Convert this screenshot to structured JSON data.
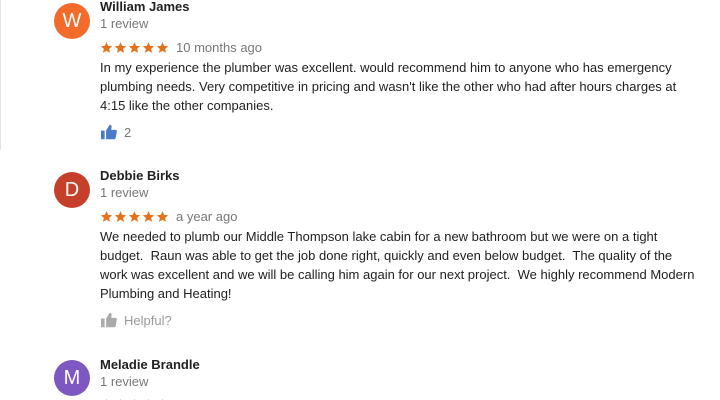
{
  "colors": {
    "avatar_w": "#f26b2a",
    "avatar_d": "#c53f2a",
    "avatar_m": "#7e57c2",
    "star": "#e7711b",
    "thumb_active": "#4a7cc8",
    "thumb_inactive": "#aaaaaa"
  },
  "reviews": [
    {
      "avatar_letter": "W",
      "name": "William James",
      "review_count": "1 review",
      "rating": 5,
      "date": "10 months ago",
      "text": "In my experience the plumber was excellent. would recommend him to anyone who has emergency\nplumbing needs. Very competitive in pricing and wasn't like the other who had after hours charges at\n4:15 like the other companies.",
      "helpful_icon": "thumbs-up-icon",
      "helpful_count": "2"
    },
    {
      "avatar_letter": "D",
      "name": "Debbie Birks",
      "review_count": "1 review",
      "rating": 5,
      "date": "a year ago",
      "text": "We needed to plumb our Middle Thompson lake cabin for a new bathroom but we were on a tight\nbudget.  Raun was able to get the job done right, quickly and even below budget.  The quality of the\nwork was excellent and we will be calling him again for our next project.  We highly recommend Modern\nPlumbing and Heating!",
      "helpful_icon": "thumbs-up-icon",
      "helpful_label": "Helpful?"
    },
    {
      "avatar_letter": "M",
      "name": "Meladie Brandle",
      "review_count": "1 review"
    }
  ]
}
